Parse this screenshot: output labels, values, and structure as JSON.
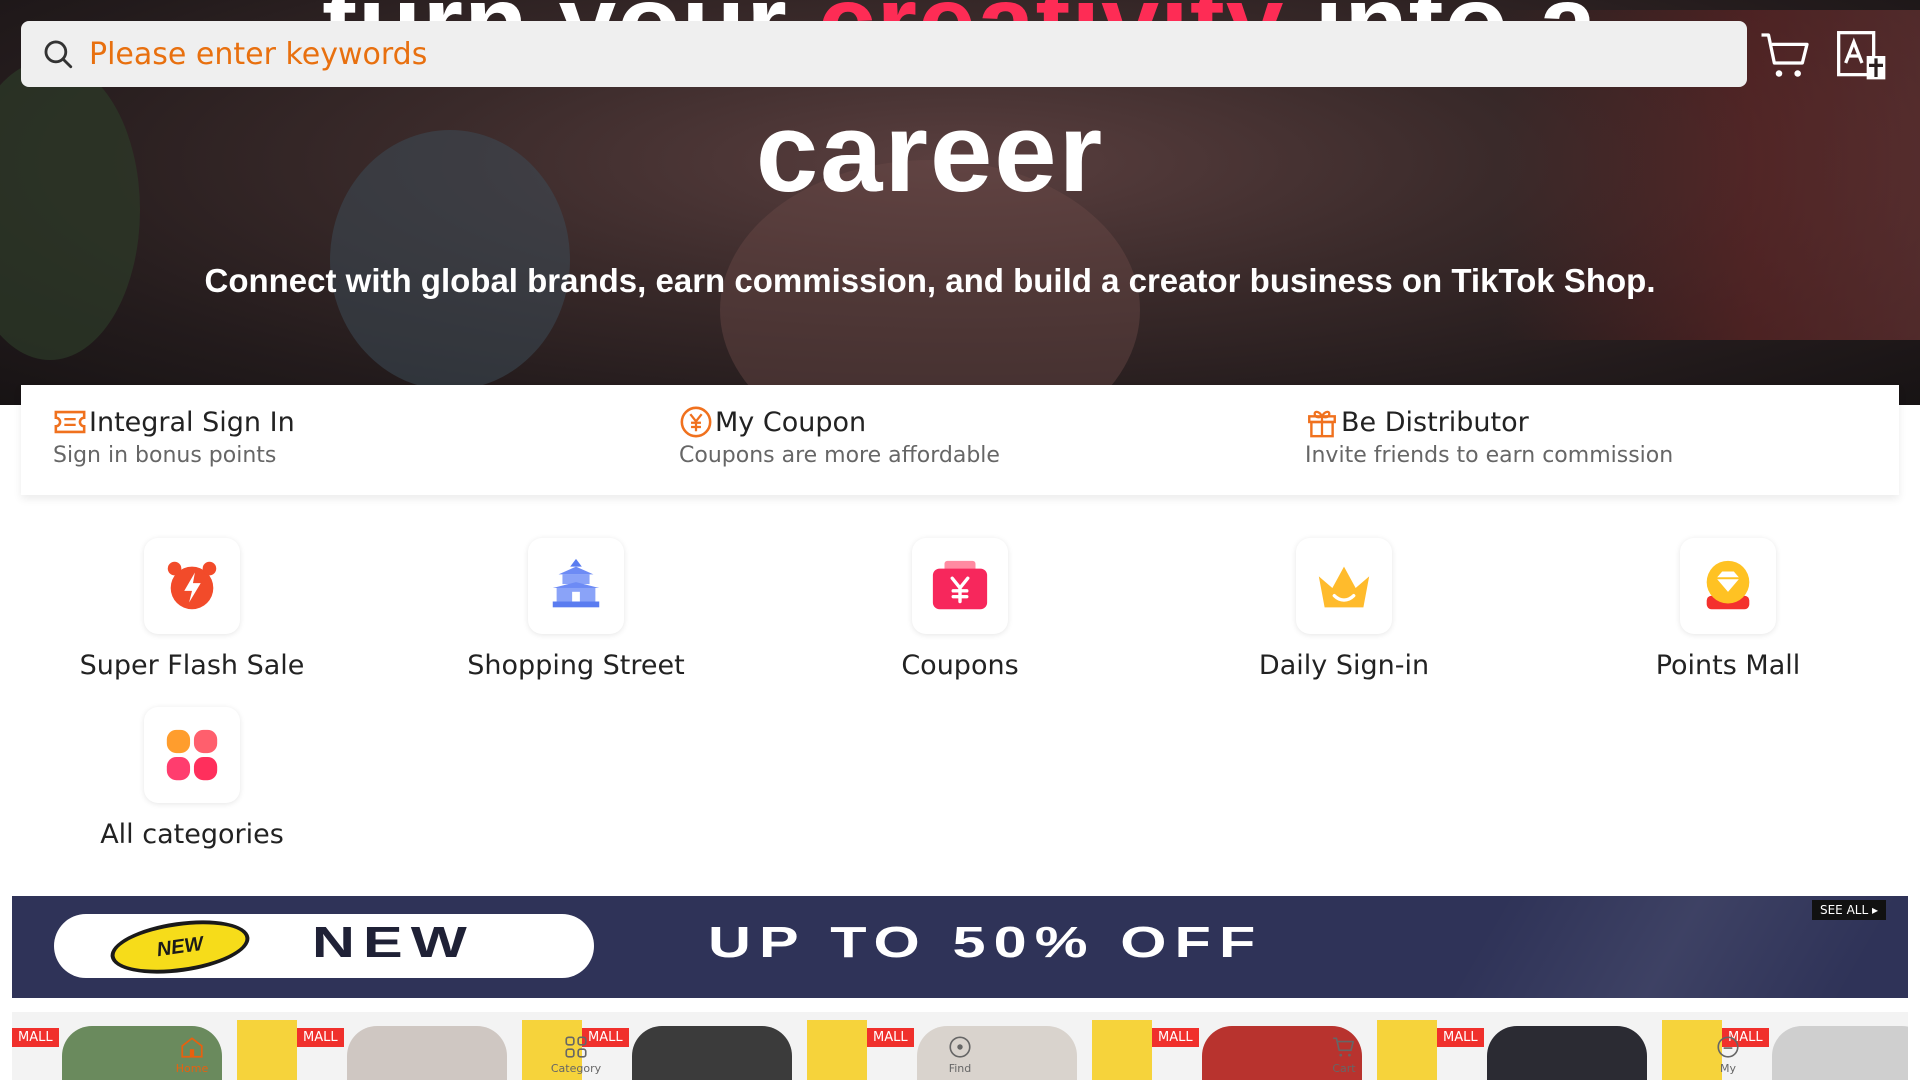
{
  "hero": {
    "line1_pre": "turn your ",
    "line1_accent": "creativity",
    "line1_post": " into a",
    "line2": "career",
    "subtitle": "Connect with global brands, earn commission, and build a creator business on TikTok Shop."
  },
  "search": {
    "placeholder": "Please enter keywords"
  },
  "header_icons": [
    "cart-icon",
    "translate-icon"
  ],
  "quick_links": [
    {
      "title": "Integral Sign In",
      "desc": "Sign in bonus points",
      "icon": "ticket-icon"
    },
    {
      "title": "My Coupon",
      "desc": "Coupons are more affordable",
      "icon": "yen-coin-icon"
    },
    {
      "title": "Be Distributor",
      "desc": "Invite friends to earn commission",
      "icon": "gift-icon"
    }
  ],
  "categories": [
    {
      "label": "Super Flash Sale",
      "icon": "alarm-clock-icon"
    },
    {
      "label": "Shopping Street",
      "icon": "temple-icon"
    },
    {
      "label": "Coupons",
      "icon": "coupon-icon"
    },
    {
      "label": "Daily Sign-in",
      "icon": "crown-icon"
    },
    {
      "label": "Points Mall",
      "icon": "diamond-icon"
    },
    {
      "label": "All categories",
      "icon": "grid-flower-icon"
    }
  ],
  "banner": {
    "badge": "NEW",
    "left_text": "NEW",
    "offer_text": "UP TO 50% OFF",
    "see_all": "SEE ALL ▸"
  },
  "product_strip": {
    "mall_label": "MALL"
  },
  "bottom_nav": [
    {
      "label": "Home",
      "active": true
    },
    {
      "label": "Category",
      "active": false
    },
    {
      "label": "Find",
      "active": false
    },
    {
      "label": "Cart",
      "active": false
    },
    {
      "label": "My",
      "active": false
    }
  ],
  "colors": {
    "accent": "#fe2c55",
    "placeholder": "#e8700f",
    "banner_bg": "#2f3358"
  }
}
